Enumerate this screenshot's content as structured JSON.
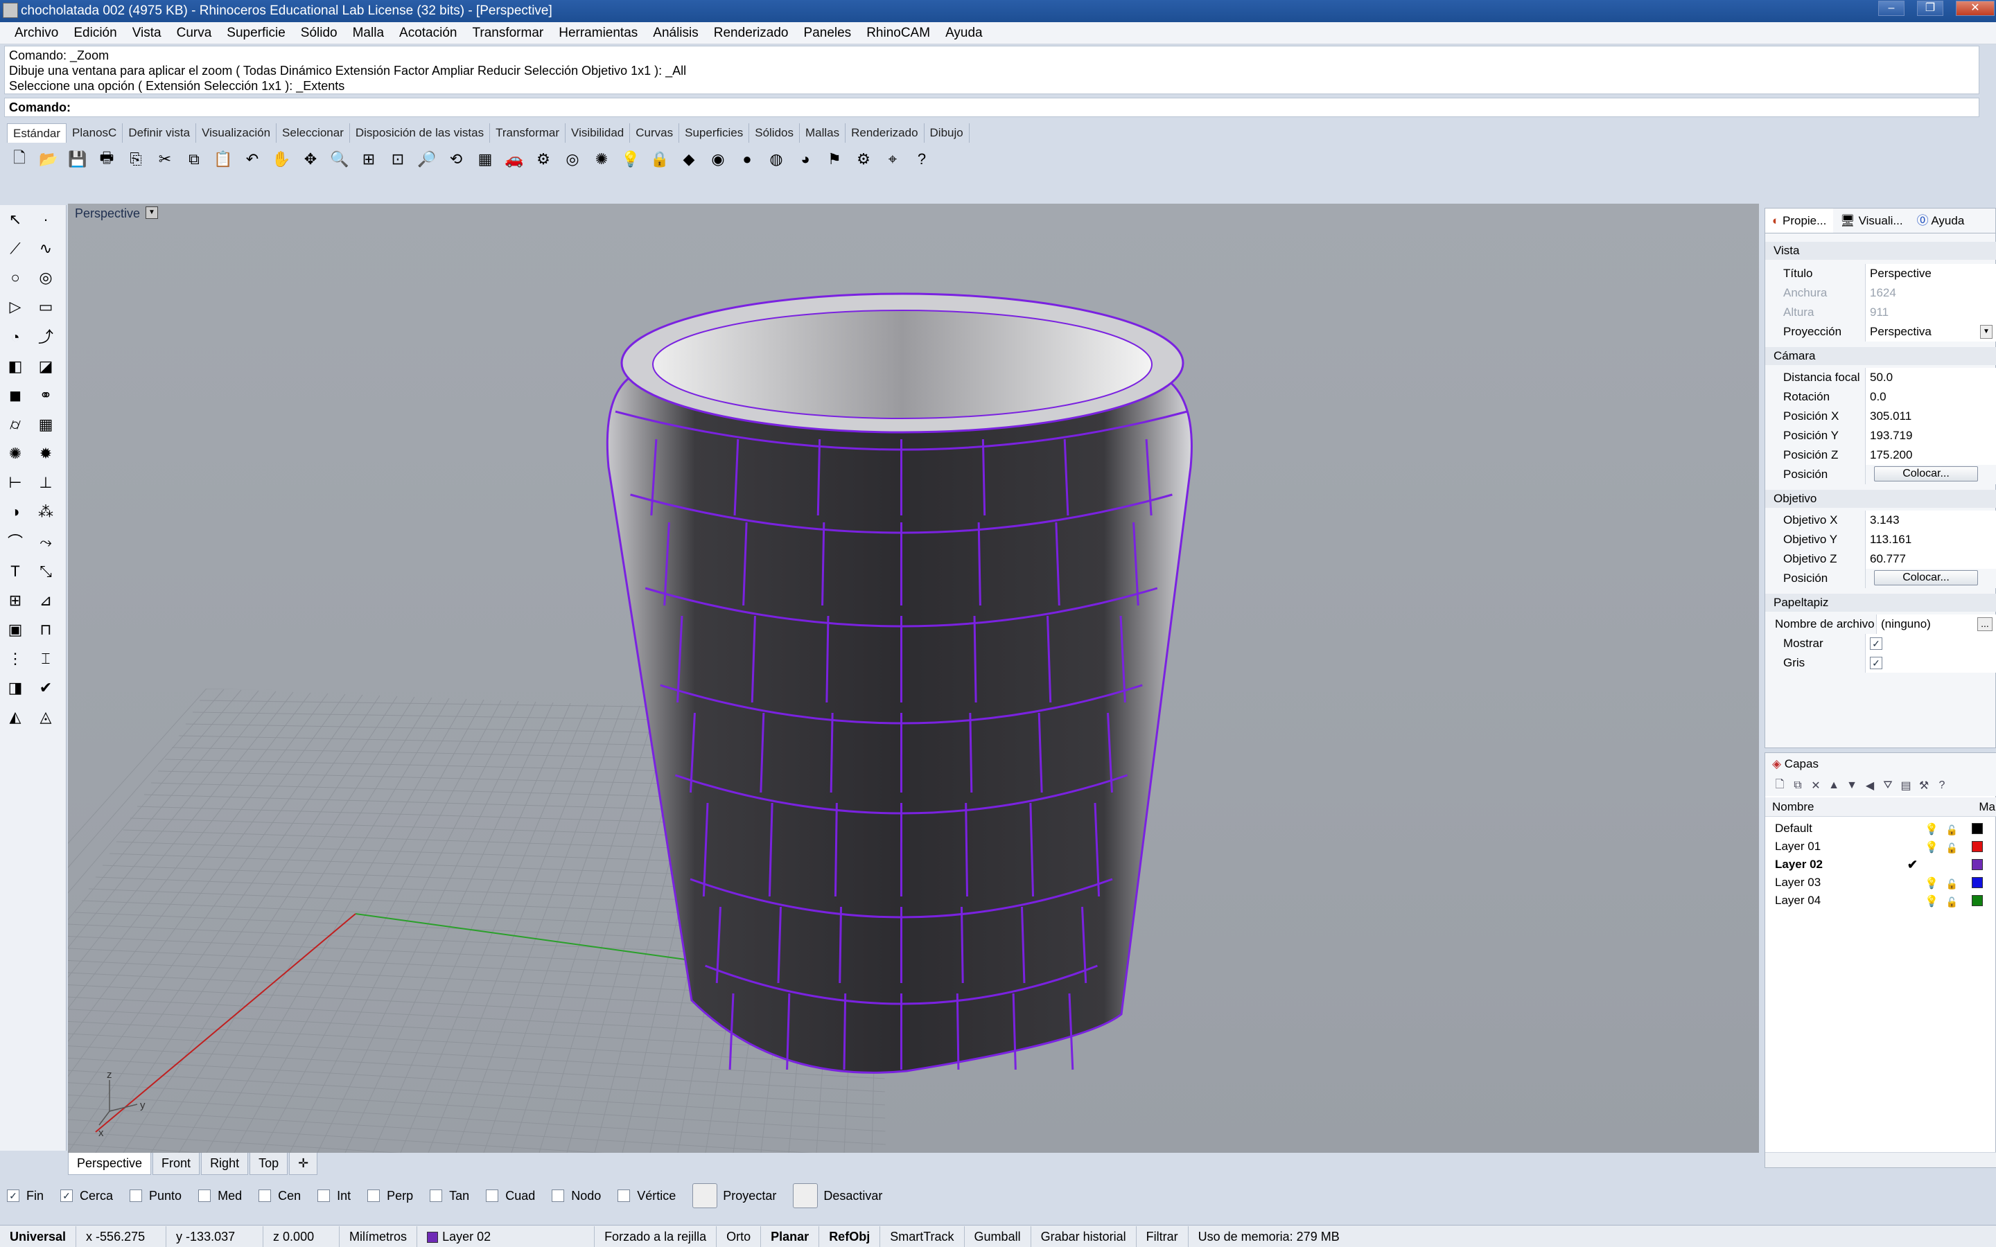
{
  "window": {
    "title": "chocholatada 002 (4975 KB) - Rhinoceros Educational Lab License (32 bits) - [Perspective]",
    "minimize": "–",
    "maximize": "❐",
    "close": "✕"
  },
  "menu": [
    "Archivo",
    "Edición",
    "Vista",
    "Curva",
    "Superficie",
    "Sólido",
    "Malla",
    "Acotación",
    "Transformar",
    "Herramientas",
    "Análisis",
    "Renderizado",
    "Paneles",
    "RhinoCAM",
    "Ayuda"
  ],
  "command": {
    "history": [
      "Comando: _Zoom",
      "Dibuje una ventana para aplicar el zoom ( Todas  Dinámico  Extensión  Factor  Ampliar  Reducir  Selección  Objetivo  1x1 ): _All",
      "Seleccione una opción ( Extensión  Selección  1x1 ): _Extents"
    ],
    "prompt": "Comando:"
  },
  "toolbar_tabs": [
    "Estándar",
    "PlanosC",
    "Definir vista",
    "Visualización",
    "Seleccionar",
    "Disposición de las vistas",
    "Transformar",
    "Visibilidad",
    "Curvas",
    "Superficies",
    "Sólidos",
    "Mallas",
    "Renderizado",
    "Dibujo"
  ],
  "toolbar_icons": [
    "new-icon",
    "open-icon",
    "save-icon",
    "print-icon",
    "import-icon",
    "cut-icon",
    "copy-icon",
    "paste-icon",
    "undo-icon",
    "pan-icon",
    "move-icon",
    "zoom-in-icon",
    "zoom-window-icon",
    "zoom-extents-icon",
    "zoom-selected-icon",
    "rotate-view-icon",
    "viewport-layout-icon",
    "car-icon",
    "render-icon",
    "target-icon",
    "light-icon",
    "bulb-icon",
    "lock-icon",
    "material-icon",
    "color-wheel-icon",
    "sphere-icon",
    "rendered-sphere-icon",
    "blue-sphere-icon",
    "flag-icon",
    "settings-icon",
    "snap-icon",
    "help-icon"
  ],
  "toolbar_glyphs": [
    "🗋",
    "📂",
    "💾",
    "🖶",
    "⎘",
    "✂",
    "⧉",
    "📋",
    "↶",
    "✋",
    "✥",
    "🔍",
    "⊞",
    "⊡",
    "🔎",
    "⟲",
    "▦",
    "🚗",
    "⚙",
    "◎",
    "✺",
    "💡",
    "🔒",
    "◆",
    "◉",
    "●",
    "◍",
    "◕",
    "⚑",
    "⚙",
    "⌖",
    "?"
  ],
  "left_tools": [
    {
      "name": "select-icon",
      "glyph": "↖"
    },
    {
      "name": "point-icon",
      "glyph": "·"
    },
    {
      "name": "polyline-icon",
      "glyph": "⟋"
    },
    {
      "name": "curve-icon",
      "glyph": "∿"
    },
    {
      "name": "circle-icon",
      "glyph": "○"
    },
    {
      "name": "ellipse-icon",
      "glyph": "◎"
    },
    {
      "name": "polygon-icon",
      "glyph": "▷"
    },
    {
      "name": "rectangle-icon",
      "glyph": "▭"
    },
    {
      "name": "arc-icon",
      "glyph": "◔"
    },
    {
      "name": "freeform-icon",
      "glyph": "⤴"
    },
    {
      "name": "surface-icon",
      "glyph": "◧"
    },
    {
      "name": "loft-icon",
      "glyph": "◪"
    },
    {
      "name": "box-icon",
      "glyph": "◼"
    },
    {
      "name": "boolean-icon",
      "glyph": "⚭"
    },
    {
      "name": "cylinder-icon",
      "glyph": "⌭"
    },
    {
      "name": "mesh-icon",
      "glyph": "▦"
    },
    {
      "name": "explode-icon",
      "glyph": "✺"
    },
    {
      "name": "explosion-icon",
      "glyph": "✹"
    },
    {
      "name": "extend-icon",
      "glyph": "⊢"
    },
    {
      "name": "trim-icon",
      "glyph": "⊥"
    },
    {
      "name": "group-icon",
      "glyph": "◑"
    },
    {
      "name": "gumball-icon",
      "glyph": "⁂"
    },
    {
      "name": "fillet-icon",
      "glyph": "⌒"
    },
    {
      "name": "offset-icon",
      "glyph": "⤳"
    },
    {
      "name": "text-icon",
      "glyph": "T"
    },
    {
      "name": "scale-icon",
      "glyph": "⤡"
    },
    {
      "name": "array-icon",
      "glyph": "⊞"
    },
    {
      "name": "analyze-icon",
      "glyph": "⊿"
    },
    {
      "name": "solid-box-icon",
      "glyph": "▣"
    },
    {
      "name": "dimension-icon",
      "glyph": "⊓"
    },
    {
      "name": "grid-array-icon",
      "glyph": "⋮"
    },
    {
      "name": "transform-icon",
      "glyph": "⌶"
    },
    {
      "name": "shell-icon",
      "glyph": "◨"
    },
    {
      "name": "check-icon",
      "glyph": "✔"
    },
    {
      "name": "mass-icon",
      "glyph": "◭"
    },
    {
      "name": "paint-icon",
      "glyph": "◬"
    }
  ],
  "viewport": {
    "label": "Perspective",
    "axis_z": "z",
    "axis_y": "y",
    "axis_x": "x"
  },
  "viewport_tabs": [
    "Perspective",
    "Front",
    "Right",
    "Top"
  ],
  "viewport_add": "✛",
  "osnap": [
    {
      "label": "Fin",
      "checked": true
    },
    {
      "label": "Cerca",
      "checked": true
    },
    {
      "label": "Punto",
      "checked": false
    },
    {
      "label": "Med",
      "checked": false
    },
    {
      "label": "Cen",
      "checked": false
    },
    {
      "label": "Int",
      "checked": false
    },
    {
      "label": "Perp",
      "checked": false
    },
    {
      "label": "Tan",
      "checked": false
    },
    {
      "label": "Cuad",
      "checked": false
    },
    {
      "label": "Nodo",
      "checked": false
    },
    {
      "label": "Vértice",
      "checked": false
    }
  ],
  "osnap_buttons": {
    "project": "Proyectar",
    "disable": "Desactivar"
  },
  "status": {
    "cplane": "Universal",
    "x": "x -556.275",
    "y": "y -133.037",
    "z": "z 0.000",
    "units": "Milímetros",
    "layer": "Layer 02",
    "layer_color": "#6f2bb6",
    "grid_snap": "Forzado a la rejilla",
    "ortho": "Orto",
    "planar": "Planar",
    "osnap": "RefObj",
    "smarttrack": "SmartTrack",
    "gumball": "Gumball",
    "history": "Grabar historial",
    "filter": "Filtrar",
    "memory": "Uso de memoria: 279 MB"
  },
  "panel_tabs": [
    "Propie...",
    "Visuali...",
    "Ayuda"
  ],
  "properties": {
    "vista_section": "Vista",
    "titulo": {
      "label": "Título",
      "value": "Perspective"
    },
    "anchura": {
      "label": "Anchura",
      "value": "1624"
    },
    "altura": {
      "label": "Altura",
      "value": "911"
    },
    "proyeccion": {
      "label": "Proyección",
      "value": "Perspectiva"
    },
    "camara_section": "Cámara",
    "distancia": {
      "label": "Distancia focal",
      "value": "50.0"
    },
    "rotacion": {
      "label": "Rotación",
      "value": "0.0"
    },
    "posx": {
      "label": "Posición X",
      "value": "305.011"
    },
    "posy": {
      "label": "Posición Y",
      "value": "193.719"
    },
    "posz": {
      "label": "Posición Z",
      "value": "175.200"
    },
    "posicion": {
      "label": "Posición",
      "button": "Colocar..."
    },
    "objetivo_section": "Objetivo",
    "objx": {
      "label": "Objetivo X",
      "value": "3.143"
    },
    "objy": {
      "label": "Objetivo Y",
      "value": "113.161"
    },
    "objz": {
      "label": "Objetivo Z",
      "value": "60.777"
    },
    "objpos": {
      "label": "Posición",
      "button": "Colocar..."
    },
    "papel_section": "Papeltapiz",
    "archivo": {
      "label": "Nombre de archivo",
      "value": "(ninguno)",
      "more": "..."
    },
    "mostrar": {
      "label": "Mostrar",
      "checked": true
    },
    "gris": {
      "label": "Gris",
      "checked": true
    }
  },
  "layers": {
    "title": "Capas",
    "col_name": "Nombre",
    "col_material": "Ma",
    "rows": [
      {
        "name": "Default",
        "color": "#000000",
        "current": false
      },
      {
        "name": "Layer 01",
        "color": "#e01010",
        "current": false
      },
      {
        "name": "Layer 02",
        "color": "#6f2bb6",
        "current": true
      },
      {
        "name": "Layer 03",
        "color": "#1010e0",
        "current": false
      },
      {
        "name": "Layer 04",
        "color": "#108010",
        "current": false
      }
    ]
  },
  "colors": {
    "accent_edge": "#7a22e0",
    "x_axis": "#c02020",
    "y_axis": "#20a020"
  }
}
